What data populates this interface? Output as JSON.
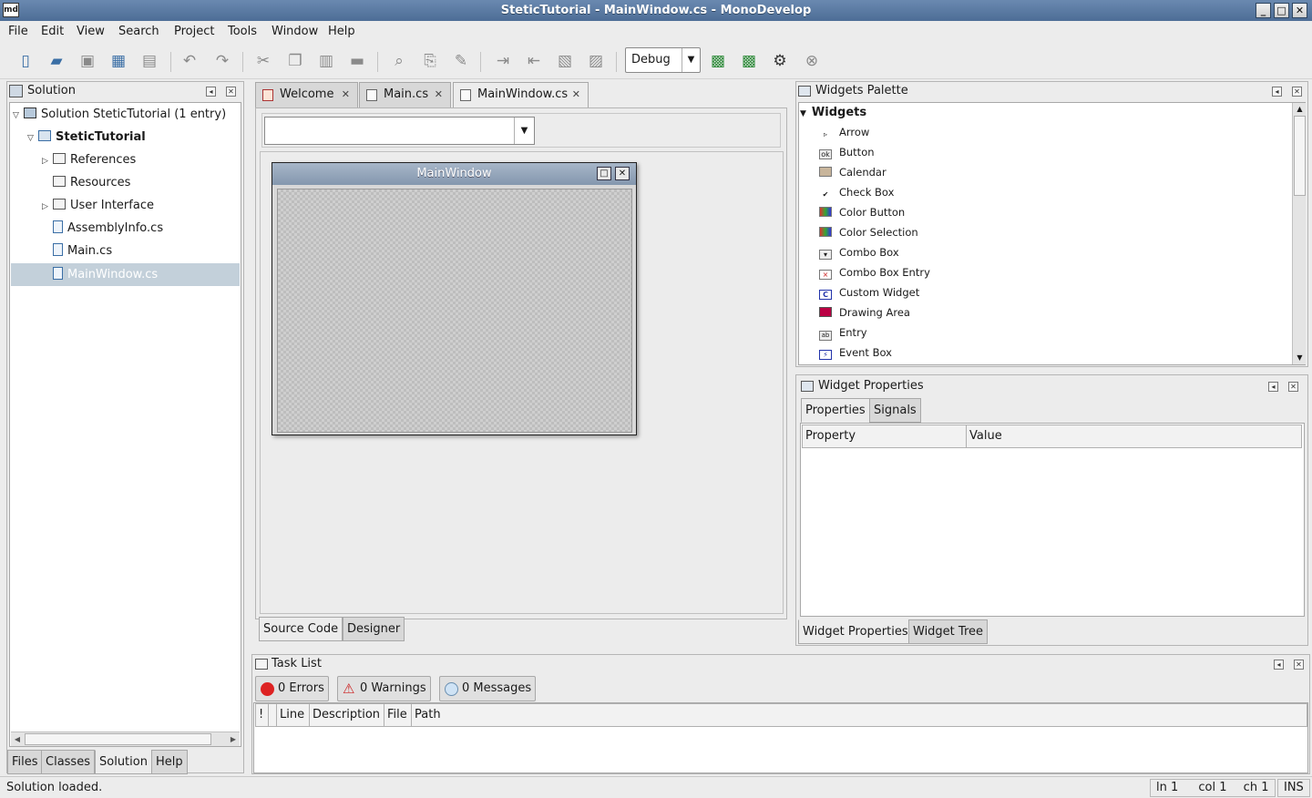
{
  "window": {
    "title": "SteticTutorial - MainWindow.cs - MonoDevelop",
    "app_icon_text": "md"
  },
  "menu": [
    "File",
    "Edit",
    "View",
    "Search",
    "Project",
    "Tools",
    "Window",
    "Help"
  ],
  "toolbar": {
    "config": "Debug"
  },
  "solution_pad": {
    "title": "Solution",
    "tree": [
      {
        "label": "Solution SteticTutorial (1 entry)"
      },
      {
        "label": "SteticTutorial"
      },
      {
        "label": "References"
      },
      {
        "label": "Resources"
      },
      {
        "label": "User Interface"
      },
      {
        "label": "AssemblyInfo.cs"
      },
      {
        "label": "Main.cs"
      },
      {
        "label": "MainWindow.cs"
      }
    ],
    "tabs": [
      "Files",
      "Classes",
      "Solution",
      "Help"
    ]
  },
  "doc_tabs": [
    "Welcome",
    "Main.cs",
    "MainWindow.cs"
  ],
  "designer": {
    "window_title": "MainWindow",
    "tabs": [
      "Source Code",
      "Designer"
    ]
  },
  "widgets_palette": {
    "title": "Widgets Palette",
    "group": "Widgets",
    "items": [
      "Arrow",
      "Button",
      "Calendar",
      "Check Box",
      "Color Button",
      "Color Selection",
      "Combo Box",
      "Combo Box Entry",
      "Custom Widget",
      "Drawing Area",
      "Entry",
      "Event Box"
    ]
  },
  "widget_properties": {
    "title": "Widget Properties",
    "tabs": [
      "Properties",
      "Signals"
    ],
    "columns": [
      "Property",
      "Value"
    ],
    "bottom_tabs": [
      "Widget Properties",
      "Widget Tree"
    ]
  },
  "task_list": {
    "title": "Task List",
    "errors": "0 Errors",
    "warnings": "0 Warnings",
    "messages": "0 Messages",
    "columns": [
      "!",
      "Line",
      "Description",
      "File",
      "Path"
    ]
  },
  "status": {
    "message": "Solution loaded.",
    "ln": "ln 1",
    "col": "col 1",
    "ch": "ch 1",
    "mode": "INS"
  }
}
